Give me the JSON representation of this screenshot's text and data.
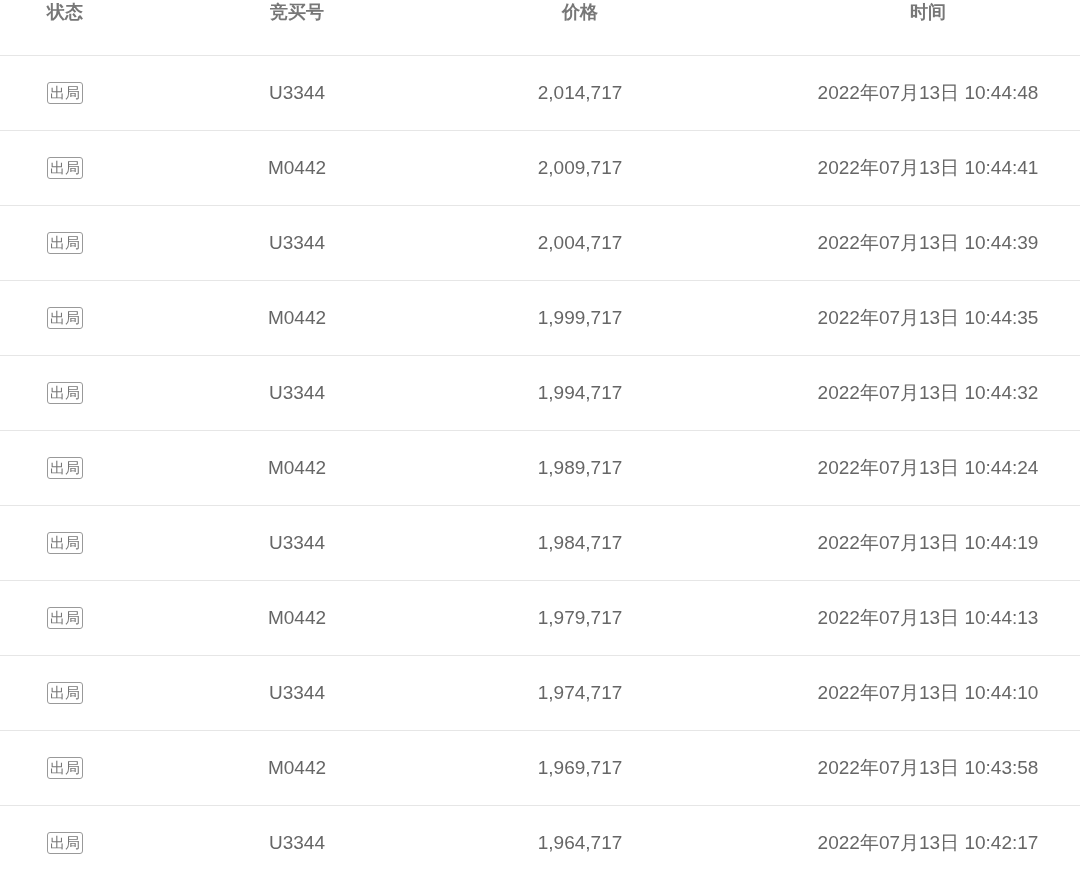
{
  "table": {
    "columns": [
      "状态",
      "竞买号",
      "价格",
      "时间"
    ],
    "rows": [
      {
        "status": "出局",
        "bidder": "U3344",
        "price": "2,014,717",
        "time": "2022年07月13日 10:44:48"
      },
      {
        "status": "出局",
        "bidder": "M0442",
        "price": "2,009,717",
        "time": "2022年07月13日 10:44:41"
      },
      {
        "status": "出局",
        "bidder": "U3344",
        "price": "2,004,717",
        "time": "2022年07月13日 10:44:39"
      },
      {
        "status": "出局",
        "bidder": "M0442",
        "price": "1,999,717",
        "time": "2022年07月13日 10:44:35"
      },
      {
        "status": "出局",
        "bidder": "U3344",
        "price": "1,994,717",
        "time": "2022年07月13日 10:44:32"
      },
      {
        "status": "出局",
        "bidder": "M0442",
        "price": "1,989,717",
        "time": "2022年07月13日 10:44:24"
      },
      {
        "status": "出局",
        "bidder": "U3344",
        "price": "1,984,717",
        "time": "2022年07月13日 10:44:19"
      },
      {
        "status": "出局",
        "bidder": "M0442",
        "price": "1,979,717",
        "time": "2022年07月13日 10:44:13"
      },
      {
        "status": "出局",
        "bidder": "U3344",
        "price": "1,974,717",
        "time": "2022年07月13日 10:44:10"
      },
      {
        "status": "出局",
        "bidder": "M0442",
        "price": "1,969,717",
        "time": "2022年07月13日 10:43:58"
      },
      {
        "status": "出局",
        "bidder": "U3344",
        "price": "1,964,717",
        "time": "2022年07月13日 10:42:17"
      }
    ]
  }
}
